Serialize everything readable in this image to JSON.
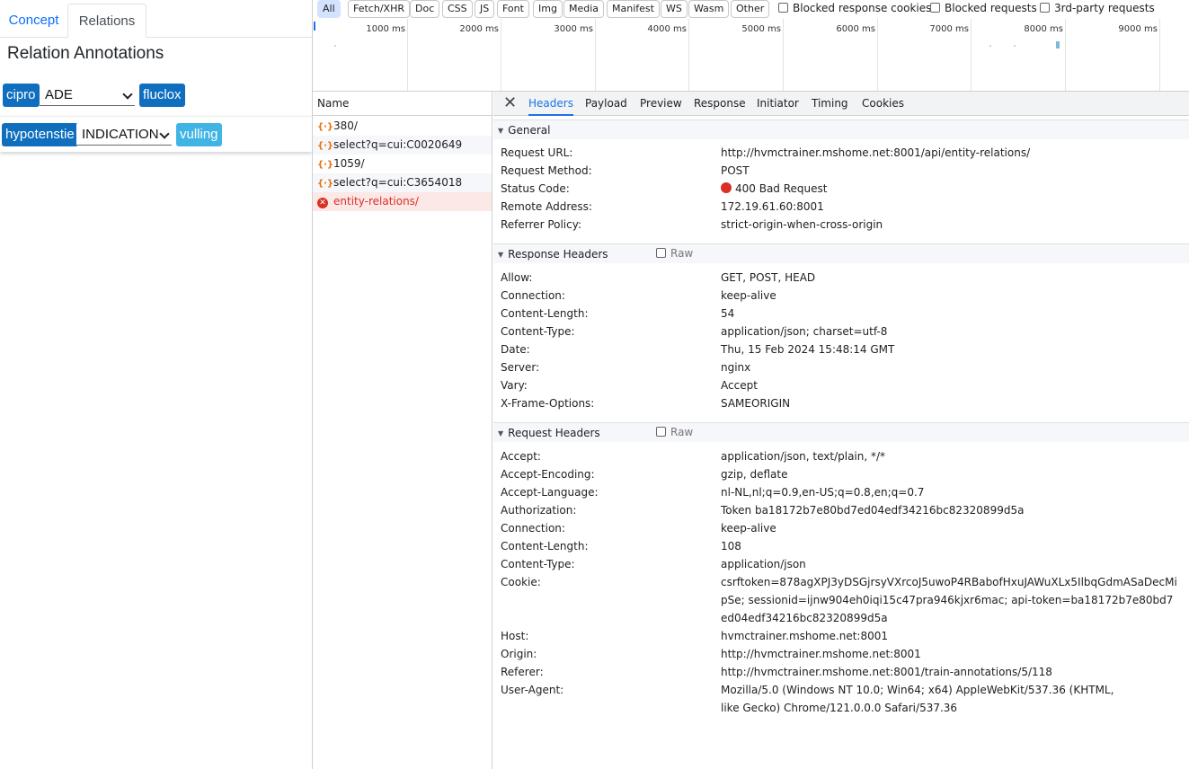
{
  "app": {
    "tabs": [
      "Concept",
      "Relations"
    ],
    "title": "Relation Annotations",
    "relations": [
      {
        "source": "cipro",
        "type": "ADE",
        "target": "fluclox"
      },
      {
        "source": "hypotenstie",
        "type": "INDICATION",
        "target": "vulling"
      }
    ]
  },
  "devtools": {
    "filters": [
      "All",
      "Fetch/XHR",
      "Doc",
      "CSS",
      "JS",
      "Font",
      "Img",
      "Media",
      "Manifest",
      "WS",
      "Wasm",
      "Other"
    ],
    "checkboxes": [
      "Blocked response cookies",
      "Blocked requests",
      "3rd-party requests"
    ],
    "timeline_labels": [
      "1000 ms",
      "2000 ms",
      "3000 ms",
      "4000 ms",
      "5000 ms",
      "6000 ms",
      "7000 ms",
      "8000 ms",
      "9000 ms"
    ],
    "name_header": "Name",
    "requests": [
      "380/",
      "select?q=cui:C0020649",
      "1059/",
      "select?q=cui:C3654018",
      "entity-relations/"
    ],
    "detail_tabs": [
      "Headers",
      "Payload",
      "Preview",
      "Response",
      "Initiator",
      "Timing",
      "Cookies"
    ],
    "raw_label": "Raw",
    "general": {
      "title": "General",
      "rows": [
        {
          "k": "Request URL:",
          "v": "http://hvmctrainer.mshome.net:8001/api/entity-relations/"
        },
        {
          "k": "Request Method:",
          "v": "POST"
        },
        {
          "k": "Status Code:",
          "v": "400 Bad Request"
        },
        {
          "k": "Remote Address:",
          "v": "172.19.61.60:8001"
        },
        {
          "k": "Referrer Policy:",
          "v": "strict-origin-when-cross-origin"
        }
      ]
    },
    "response_headers": {
      "title": "Response Headers",
      "rows": [
        {
          "k": "Allow:",
          "v": "GET, POST, HEAD"
        },
        {
          "k": "Connection:",
          "v": "keep-alive"
        },
        {
          "k": "Content-Length:",
          "v": "54"
        },
        {
          "k": "Content-Type:",
          "v": "application/json; charset=utf-8"
        },
        {
          "k": "Date:",
          "v": "Thu, 15 Feb 2024 15:48:14 GMT"
        },
        {
          "k": "Server:",
          "v": "nginx"
        },
        {
          "k": "Vary:",
          "v": "Accept"
        },
        {
          "k": "X-Frame-Options:",
          "v": "SAMEORIGIN"
        }
      ]
    },
    "request_headers": {
      "title": "Request Headers",
      "rows": [
        {
          "k": "Accept:",
          "v": "application/json, text/plain, */*"
        },
        {
          "k": "Accept-Encoding:",
          "v": "gzip, deflate"
        },
        {
          "k": "Accept-Language:",
          "v": "nl-NL,nl;q=0.9,en-US;q=0.8,en;q=0.7"
        },
        {
          "k": "Authorization:",
          "v": "Token ba18172b7e80bd7ed04edf34216bc82320899d5a"
        },
        {
          "k": "Connection:",
          "v": "keep-alive"
        },
        {
          "k": "Content-Length:",
          "v": "108"
        },
        {
          "k": "Content-Type:",
          "v": "application/json"
        },
        {
          "k": "Cookie:",
          "v": "csrftoken=878agXPJ3yDSGjrsyVXrcoJ5uwoP4RBabofHxuJAWuXLx5IlbqGdmASaDecMipSe; sessionid=ijnw904eh0iqi15c47pra946kjxr6mac; api-token=ba18172b7e80bd7ed04edf34216bc82320899d5a"
        },
        {
          "k": "Host:",
          "v": "hvmctrainer.mshome.net:8001"
        },
        {
          "k": "Origin:",
          "v": "http://hvmctrainer.mshome.net:8001"
        },
        {
          "k": "Referer:",
          "v": "http://hvmctrainer.mshome.net:8001/train-annotations/5/118"
        },
        {
          "k": "User-Agent:",
          "v": "Mozilla/5.0 (Windows NT 10.0; Win64; x64) AppleWebKit/537.36 (KHTML, like Gecko) Chrome/121.0.0.0 Safari/537.36"
        }
      ]
    }
  }
}
